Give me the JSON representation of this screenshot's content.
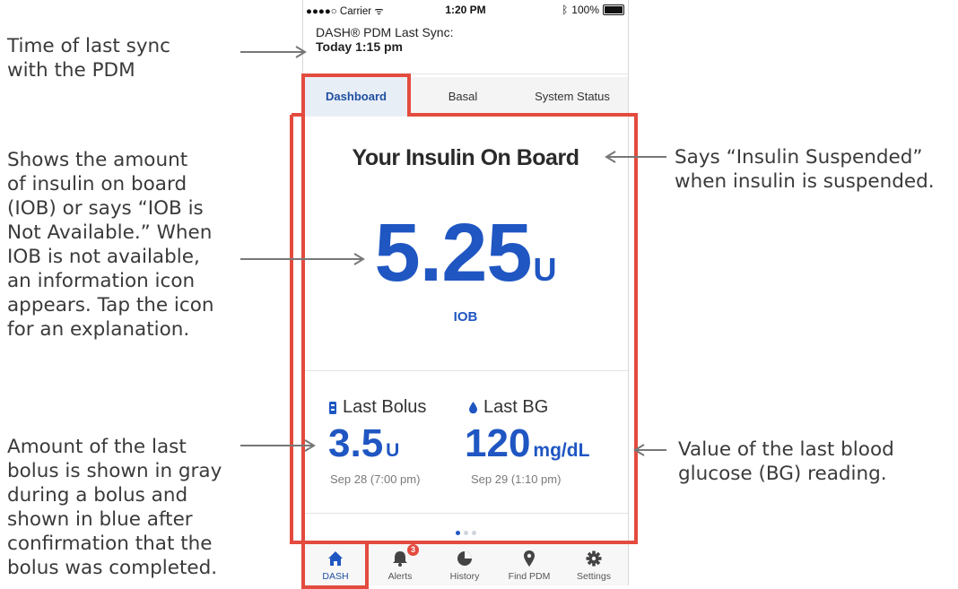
{
  "callouts": {
    "sync": "Time of last sync\nwith the PDM",
    "iob": "Shows the amount\nof insulin on board\n(IOB) or says “IOB is\nNot Available.” When\nIOB is not available,\nan information icon\nappears. Tap the icon\nfor an explanation.",
    "bolus": "Amount of the last\nbolus is shown in gray\nduring a bolus and\nshown in blue after\nconfirmation that the\nbolus was completed.",
    "suspended": "Says “Insulin Suspended”\nwhen insulin is suspended.",
    "bg": "Value of the last blood\nglucose (BG) reading."
  },
  "status_bar": {
    "carrier": "●●●●○ Carrier",
    "time": "1:20 PM",
    "battery": "100%"
  },
  "sync": {
    "label": "DASH® PDM Last Sync:",
    "time": "Today 1:15 pm"
  },
  "tabs": [
    {
      "label": "Dashboard",
      "active": true
    },
    {
      "label": "Basal",
      "active": false
    },
    {
      "label": "System Status",
      "active": false
    }
  ],
  "iob": {
    "title": "Your Insulin On Board",
    "value": "5.25",
    "unit": "U",
    "label": "IOB"
  },
  "last_bolus": {
    "label": "Last Bolus",
    "value": "3.5",
    "unit": "U",
    "date": "Sep 28 (7:00 pm)"
  },
  "last_bg": {
    "label": "Last BG",
    "value": "120",
    "unit": "mg/dL",
    "date": "Sep 29 (1:10 pm)"
  },
  "nav": [
    {
      "label": "DASH",
      "icon": "home-icon"
    },
    {
      "label": "Alerts",
      "icon": "bell-icon",
      "badge": "3"
    },
    {
      "label": "History",
      "icon": "pie-chart-icon"
    },
    {
      "label": "Find PDM",
      "icon": "location-pin-icon"
    },
    {
      "label": "Settings",
      "icon": "gear-icon"
    }
  ],
  "colors": {
    "accent": "#1f56c2",
    "annotation": "#e34b3e"
  }
}
